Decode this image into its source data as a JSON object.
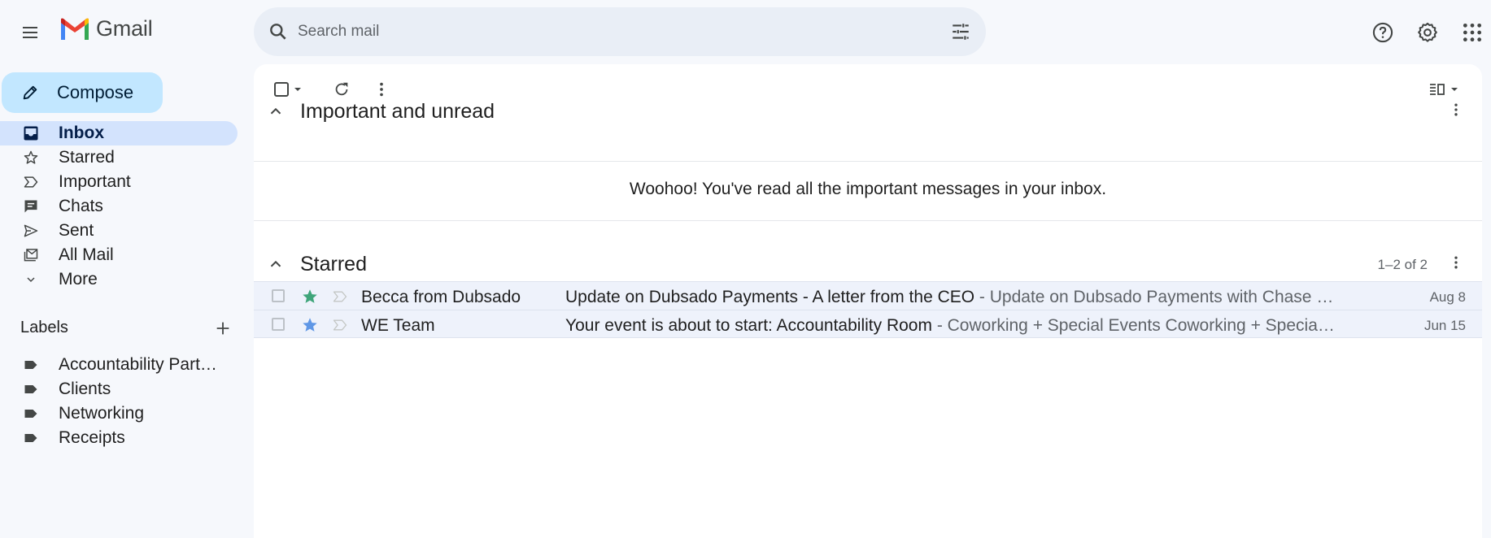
{
  "app": {
    "name": "Gmail"
  },
  "search": {
    "placeholder": "Search mail"
  },
  "compose": {
    "label": "Compose"
  },
  "nav": {
    "items": [
      {
        "label": "Inbox",
        "icon": "inbox-icon",
        "active": true
      },
      {
        "label": "Starred",
        "icon": "star-outline-icon"
      },
      {
        "label": "Important",
        "icon": "important-icon"
      },
      {
        "label": "Chats",
        "icon": "chat-icon"
      },
      {
        "label": "Sent",
        "icon": "send-icon"
      },
      {
        "label": "All Mail",
        "icon": "all-mail-icon"
      },
      {
        "label": "More",
        "icon": "chevron-down-icon"
      }
    ]
  },
  "labels": {
    "title": "Labels",
    "items": [
      {
        "label": "Accountability Part…"
      },
      {
        "label": "Clients"
      },
      {
        "label": "Networking"
      },
      {
        "label": "Receipts"
      }
    ]
  },
  "sections": {
    "important": {
      "title": "Important and unread",
      "empty_message": "Woohoo! You've read all the important messages in your inbox."
    },
    "starred": {
      "title": "Starred",
      "count": "1–2 of 2",
      "rows": [
        {
          "sender": "Becca from Dubsado",
          "subject": "Update on Dubsado Payments - A letter from the CEO",
          "snippet": " - Update on Dubsado Payments with Chase …",
          "date": "Aug 8",
          "star_color": "#3fa57a"
        },
        {
          "sender": "WE Team",
          "subject": "Your event is about to start: Accountability Room",
          "snippet": " - Coworking + Special Events Coworking + Specia…",
          "date": "Jun 15",
          "star_color": "#5f97e6"
        }
      ]
    }
  },
  "colors": {
    "background": "#f6f8fc",
    "compose_bg": "#c2e7ff",
    "active_nav": "#d3e3fd",
    "search_bg": "#e9eef6",
    "row_bg": "#eef2fb"
  }
}
